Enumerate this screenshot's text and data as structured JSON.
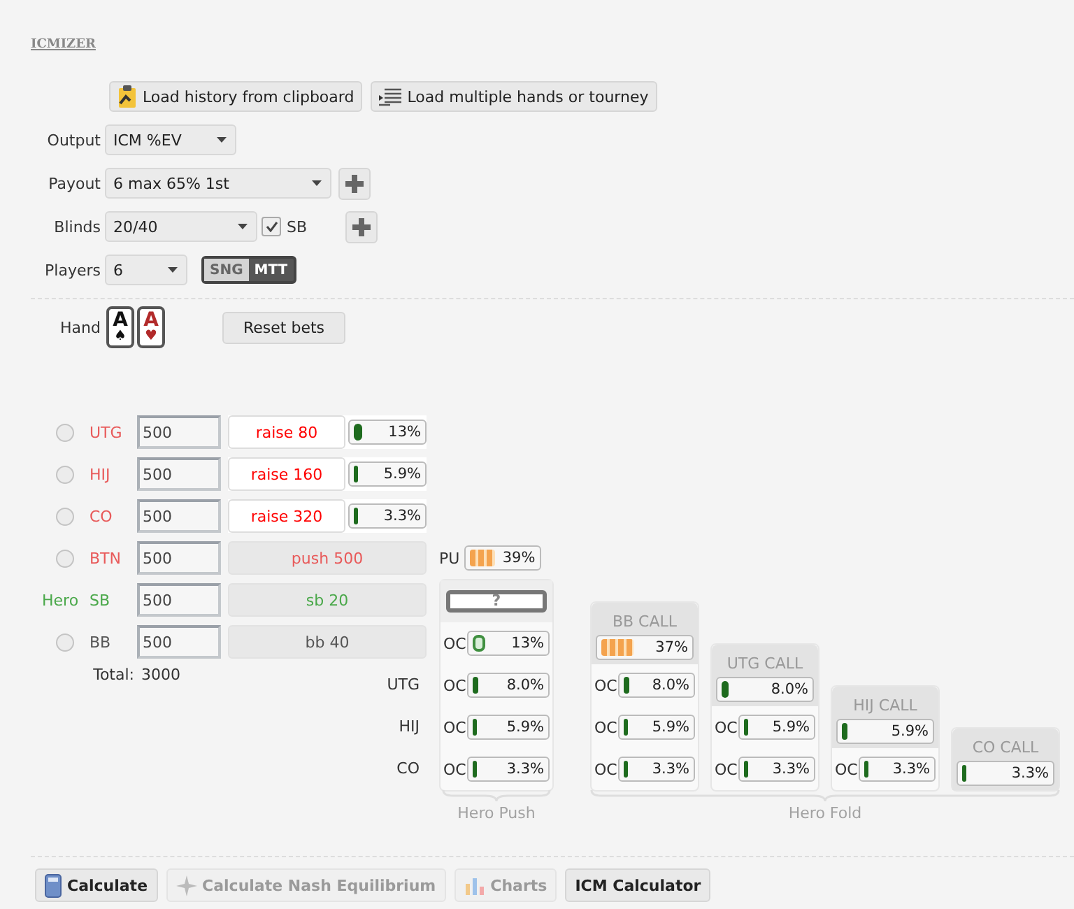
{
  "app_title": "ICMIZER",
  "load_buttons": [
    {
      "kind": "clipboard",
      "label": "Load history from clipboard"
    },
    {
      "kind": "list",
      "label": "Load multiple hands or tourney"
    }
  ],
  "output": {
    "label": "Output",
    "value": "ICM %EV"
  },
  "payout": {
    "label": "Payout",
    "value": "6 max 65% 1st"
  },
  "blinds": {
    "label": "Blinds",
    "value": "20/40",
    "sb_checkbox": {
      "label": "SB",
      "checked": true
    }
  },
  "players_count": {
    "label": "Players",
    "value": "6",
    "modes": [
      {
        "label": "SNG",
        "selected": true
      },
      {
        "label": "MTT",
        "selected": false
      }
    ]
  },
  "hand": {
    "label": "Hand",
    "cards": [
      {
        "rank": "A",
        "suit": "♠",
        "color": "#111111"
      },
      {
        "rank": "A",
        "suit": "♥",
        "color": "#b22a2a"
      }
    ]
  },
  "reset_button": "Reset bets",
  "players": [
    {
      "position": "UTG",
      "color": "#e85a5a",
      "selected": false,
      "stack": "500",
      "action": {
        "kind": "raise",
        "text": "raise 80",
        "meter": {
          "kind": "solid",
          "level": 0.13,
          "reading": "13%"
        }
      }
    },
    {
      "position": "HIJ",
      "color": "#e85a5a",
      "selected": false,
      "stack": "500",
      "action": {
        "kind": "raise",
        "text": "raise 160",
        "meter": {
          "kind": "solid",
          "level": 0.059,
          "reading": "5.9%"
        }
      }
    },
    {
      "position": "CO",
      "color": "#e85a5a",
      "selected": false,
      "stack": "500",
      "action": {
        "kind": "raise",
        "text": "raise 320",
        "meter": {
          "kind": "solid",
          "level": 0.033,
          "reading": "3.3%"
        }
      }
    },
    {
      "position": "BTN",
      "color": "#e85a5a",
      "selected": false,
      "stack": "500",
      "action": {
        "kind": "push",
        "text": "push 500"
      }
    },
    {
      "position": "SB",
      "color": "#4aa84a",
      "hero_label": "Hero",
      "stack": "500",
      "action": {
        "kind": "blind",
        "text": "sb 20"
      }
    },
    {
      "position": "BB",
      "color": "#555555",
      "selected": false,
      "stack": "500",
      "action": {
        "kind": "blind",
        "text": "bb 40"
      }
    }
  ],
  "total": {
    "label": "Total:",
    "value": "3000"
  },
  "pu": {
    "label": "PU",
    "meter": {
      "kind": "striped",
      "level": 0.39,
      "reading": "39%"
    }
  },
  "row_labels": [
    "UTG",
    "HIJ",
    "CO"
  ],
  "hero_push": {
    "button": "?",
    "caption": "Hero Push",
    "rows": [
      {
        "label": "OC",
        "meter": {
          "kind": "outline",
          "level": 0.13,
          "reading": "13%"
        }
      },
      {
        "label": "OC",
        "meter": {
          "kind": "solid",
          "level": 0.08,
          "reading": "8.0%"
        }
      },
      {
        "label": "OC",
        "meter": {
          "kind": "solid",
          "level": 0.059,
          "reading": "5.9%"
        }
      },
      {
        "label": "OC",
        "meter": {
          "kind": "solid",
          "level": 0.033,
          "reading": "3.3%"
        }
      }
    ]
  },
  "hero_fold": {
    "caption": "Hero Fold",
    "columns": [
      {
        "title": "BB CALL",
        "meter": {
          "kind": "striped",
          "level": 0.37,
          "reading": "37%"
        },
        "rows": [
          {
            "label": "OC",
            "meter": {
              "kind": "solid",
              "level": 0.08,
              "reading": "8.0%"
            }
          },
          {
            "label": "OC",
            "meter": {
              "kind": "solid",
              "level": 0.059,
              "reading": "5.9%"
            }
          },
          {
            "label": "OC",
            "meter": {
              "kind": "solid",
              "level": 0.033,
              "reading": "3.3%"
            }
          }
        ]
      },
      {
        "title": "UTG CALL",
        "meter": {
          "kind": "solid",
          "level": 0.08,
          "reading": "8.0%"
        },
        "rows": [
          {
            "label": "OC",
            "meter": {
              "kind": "solid",
              "level": 0.059,
              "reading": "5.9%"
            }
          },
          {
            "label": "OC",
            "meter": {
              "kind": "solid",
              "level": 0.033,
              "reading": "3.3%"
            }
          }
        ]
      },
      {
        "title": "HIJ CALL",
        "meter": {
          "kind": "solid",
          "level": 0.059,
          "reading": "5.9%"
        },
        "rows": [
          {
            "label": "OC",
            "meter": {
              "kind": "solid",
              "level": 0.033,
              "reading": "3.3%"
            }
          }
        ]
      },
      {
        "title": "CO CALL",
        "meter": {
          "kind": "solid",
          "level": 0.033,
          "reading": "3.3%"
        }
      }
    ]
  },
  "bottom_buttons": [
    {
      "kind": "calculator",
      "label": "Calculate",
      "disabled": false
    },
    {
      "kind": "nash",
      "label": "Calculate Nash Equilibrium",
      "disabled": true
    },
    {
      "kind": "charts",
      "label": "Charts",
      "disabled": true
    },
    {
      "kind": "plain",
      "label": "ICM Calculator",
      "disabled": false
    }
  ]
}
